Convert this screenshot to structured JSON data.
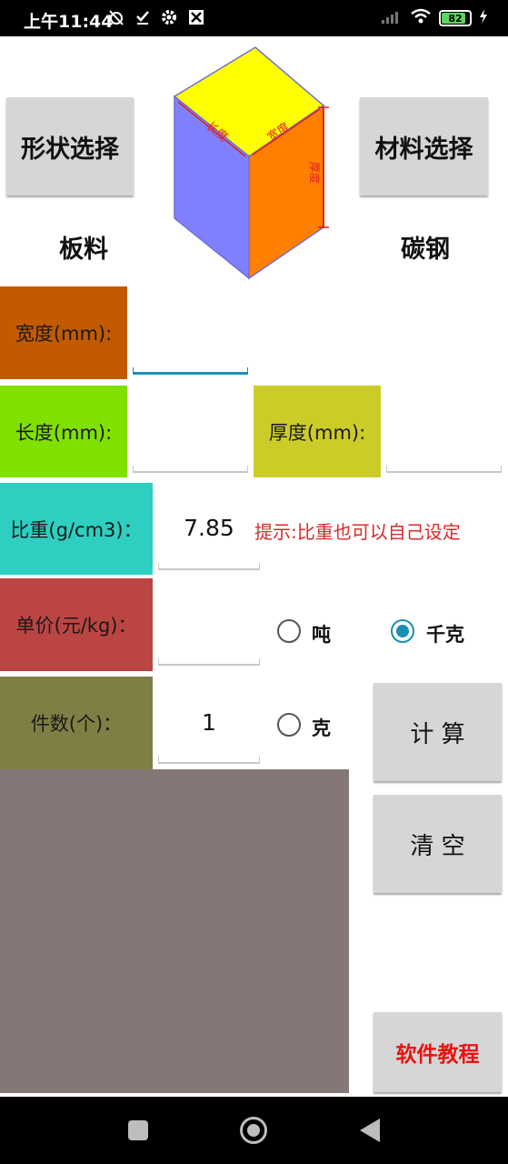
{
  "status_bar": {
    "time": "上午11:44",
    "battery": "82",
    "icons_left": [
      "alarm-off-icon",
      "check-icon",
      "gear-icon",
      "app-icon"
    ],
    "icons_right": [
      "signal-icon",
      "wifi-icon",
      "battery-icon",
      "charging-icon"
    ]
  },
  "shape": {
    "button_label": "形状选择",
    "selected": "板料",
    "diagram": {
      "length_label": "长度",
      "width_label": "宽度",
      "thickness_label": "厚度",
      "colors": {
        "top": "#ffff00",
        "left": "#8080ff",
        "right": "#ff8000",
        "dim_line": "#e02020"
      }
    }
  },
  "material": {
    "button_label": "材料选择",
    "selected": "碳钢"
  },
  "inputs": {
    "width_label": "宽度(mm):",
    "width_value": "",
    "length_label": "长度(mm):",
    "length_value": "",
    "thickness_label": "厚度(mm):",
    "thickness_value": "",
    "density_label": "比重(g/cm3)：",
    "density_value": "7.85",
    "density_hint": "提示:比重也可以自己设定",
    "price_label": "单价(元/kg)：",
    "price_value": "",
    "count_label": "件数(个)：",
    "count_value": "1"
  },
  "units": {
    "ton_label": "吨",
    "kg_label": "千克",
    "gram_label": "克",
    "selected": "千克"
  },
  "actions": {
    "calculate_label": "计  算",
    "clear_label": "清  空",
    "tutorial_label": "软件教程"
  },
  "colors": {
    "width_bg": "#c25a00",
    "length_bg": "#80e000",
    "thickness_bg": "#cccc29",
    "density_bg": "#2ecec0",
    "price_bg": "#ba4542",
    "count_bg": "#7f7f45",
    "result_bg": "#857775",
    "hint": "#d92a2a",
    "tutorial_text": "#ee1111"
  }
}
